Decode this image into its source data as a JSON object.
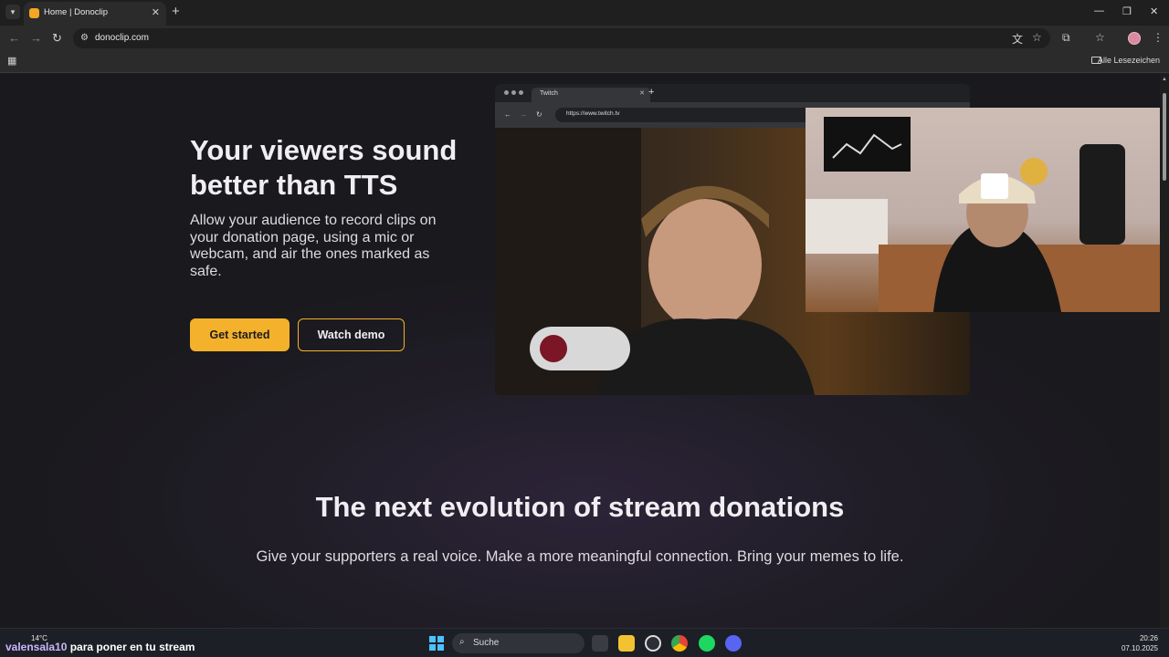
{
  "browser": {
    "tab_title": "Home | Donoclip",
    "url": "donoclip.com",
    "bookmarks_label": "Alle Lesezeichen",
    "window_controls": [
      "—",
      "❐",
      "✕"
    ]
  },
  "hero": {
    "title": "Your viewers sound better than TTS",
    "subtitle": "Allow your audience to record clips on your donation page, using a mic or webcam, and air the ones marked as safe.",
    "get_started": "Get started",
    "watch_demo": "Watch demo"
  },
  "mock_browser": {
    "tab_title": "Twitch",
    "url": "https://www.twitch.tv"
  },
  "section": {
    "title": "The next evolution of stream donations",
    "subtitle": "Give your supporters a real voice. Make a more meaningful connection. Bring your memes to life."
  },
  "taskbar": {
    "weather": "14°C",
    "overlay_user": "valensala10",
    "overlay_text": " para poner en tu stream",
    "search": "Suche",
    "time": "20:26",
    "date": "07.10.2025"
  },
  "colors": {
    "accent": "#f4b22c",
    "background": "#1c1a20"
  }
}
